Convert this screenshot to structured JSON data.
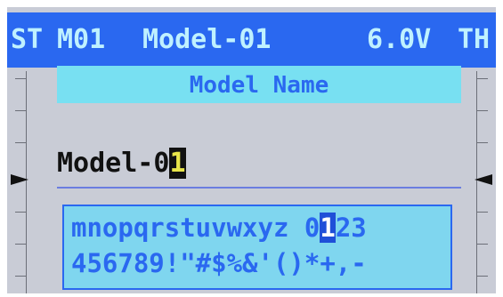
{
  "header": {
    "st_label": "ST",
    "model_id": "M01",
    "model_name": "Model-01",
    "voltage": "6.0V",
    "th_label": "TH"
  },
  "editor": {
    "title": "Model Name",
    "name_prefix": "Model-0",
    "name_cursor_char": "1"
  },
  "charset": {
    "row1_before": "mnopqrstuvwxyz 0",
    "row1_selected": "1",
    "row1_after": "23",
    "row2": "456789!\"#$%&'()*+,-"
  },
  "colors": {
    "header_bg": "#2a68f0",
    "header_text": "#bff1ff",
    "title_bg": "#78e0f2",
    "charset_bg": "#7fd6ef",
    "cursor_bg": "#111111",
    "cursor_text": "#e8e54a"
  },
  "icons": {
    "left_trim_pointer": "triangle-right-icon",
    "right_trim_pointer": "triangle-left-icon"
  }
}
